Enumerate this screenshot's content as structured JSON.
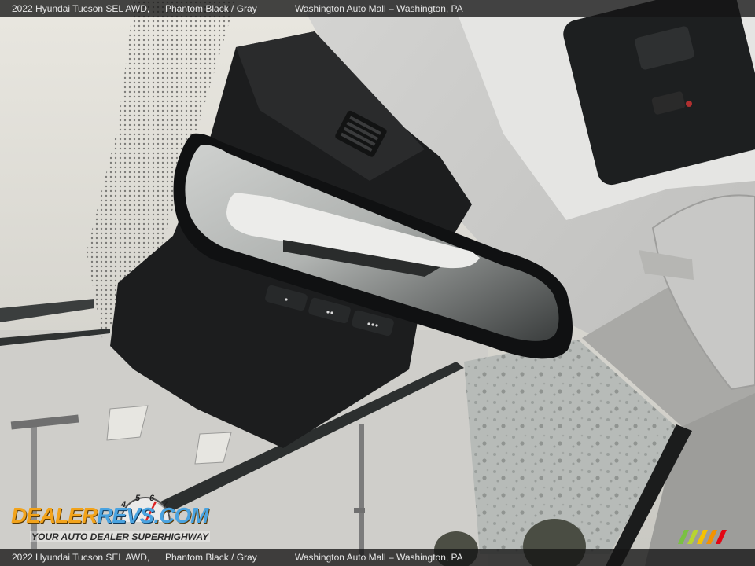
{
  "caption": {
    "vehicle": "2022 Hyundai Tucson SEL AWD,",
    "color": "Phantom Black / Gray",
    "dealer": "Washington Auto Mall – Washington, PA"
  },
  "watermark": {
    "brand_part1": "Dealer",
    "brand_part2": "Revs",
    "brand_suffix": ".com",
    "tagline": "Your Auto Dealer SuperHighway",
    "gauge_numbers": [
      "4",
      "5",
      "6",
      "7"
    ],
    "colors": {
      "dealer": "#f2a31b",
      "revs": "#4aa3e0"
    }
  },
  "corner_logo_colors": [
    "#7ac142",
    "#b8d430",
    "#f6c200",
    "#f39200",
    "#e30613"
  ]
}
